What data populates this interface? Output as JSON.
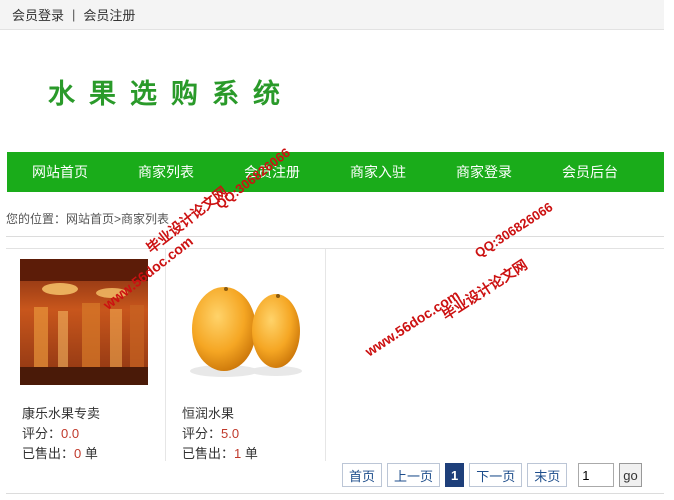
{
  "topbar": {
    "login": "会员登录",
    "separator": "|",
    "register": "会员注册"
  },
  "logo": {
    "text": "水果选购系统",
    "color": "#2a9a2a"
  },
  "nav": {
    "color": "#1aac1a",
    "items": [
      "网站首页",
      "商家列表",
      "会员注册",
      "商家入驻",
      "商家登录",
      "会员后台"
    ]
  },
  "breadcrumb": {
    "text": "您的位置：网站首页>商家列表"
  },
  "shops": [
    {
      "name": "康乐水果专卖",
      "rating_label": "评分：",
      "rating": "0.0",
      "sold_label": "已售出：",
      "sold": "0",
      "sold_unit": "单",
      "image": "store-interior"
    },
    {
      "name": "恒润水果",
      "rating_label": "评分：",
      "rating": "5.0",
      "sold_label": "已售出：",
      "sold": "1",
      "sold_unit": "单",
      "image": "oranges"
    }
  ],
  "pager": {
    "first": "首页",
    "prev": "上一页",
    "current": "1",
    "next": "下一页",
    "last": "末页",
    "page_input": "1",
    "go": "go"
  },
  "watermarks": {
    "site": "www.56doc.com",
    "qq": "QQ:306826066",
    "brand": "毕业设计论文网",
    "color": "#cc1111"
  }
}
